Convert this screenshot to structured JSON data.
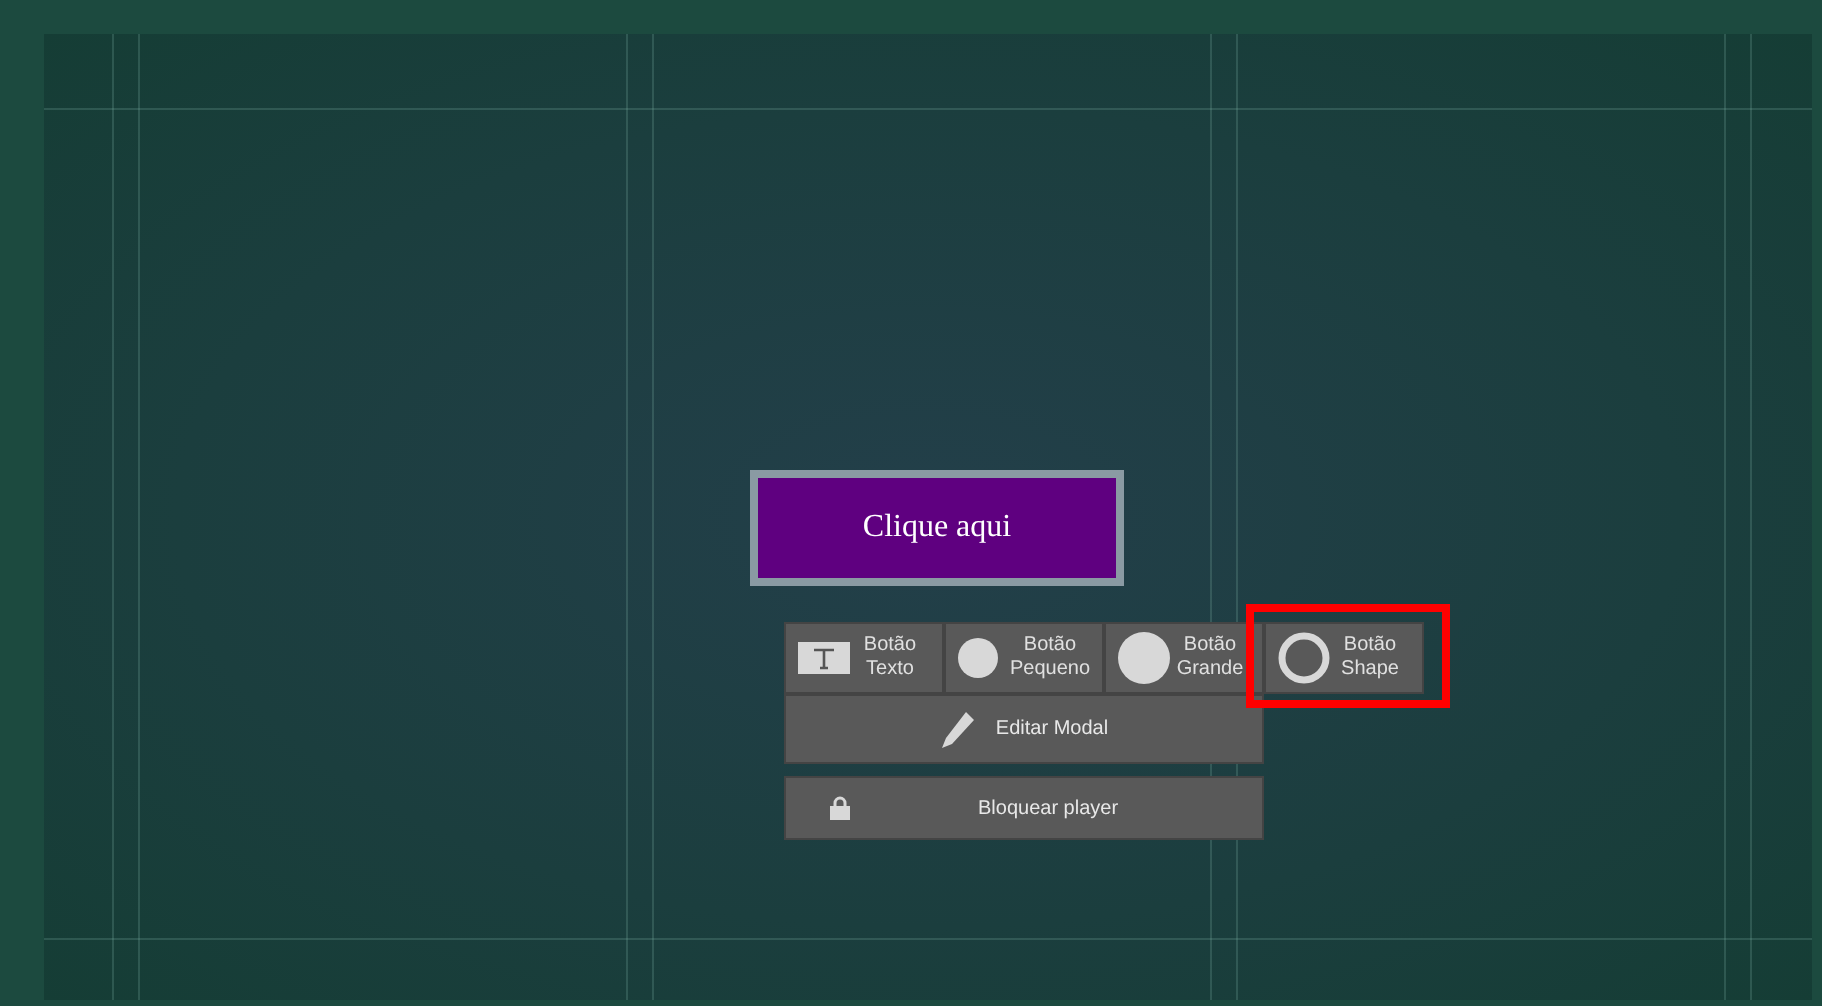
{
  "canvas": {
    "button": {
      "label": "Clique aqui"
    }
  },
  "toolbar": {
    "items": [
      {
        "kind": "text",
        "label": "Botão Texto",
        "highlighted": false
      },
      {
        "kind": "small",
        "label": "Botão Pequeno",
        "highlighted": false
      },
      {
        "kind": "large",
        "label": "Botão Grande",
        "highlighted": false
      },
      {
        "kind": "shape",
        "label": "Botão Shape",
        "highlighted": true
      }
    ]
  },
  "actions": [
    {
      "kind": "edit",
      "label": "Editar Modal"
    },
    {
      "kind": "lock",
      "label": "Bloquear player"
    }
  ]
}
